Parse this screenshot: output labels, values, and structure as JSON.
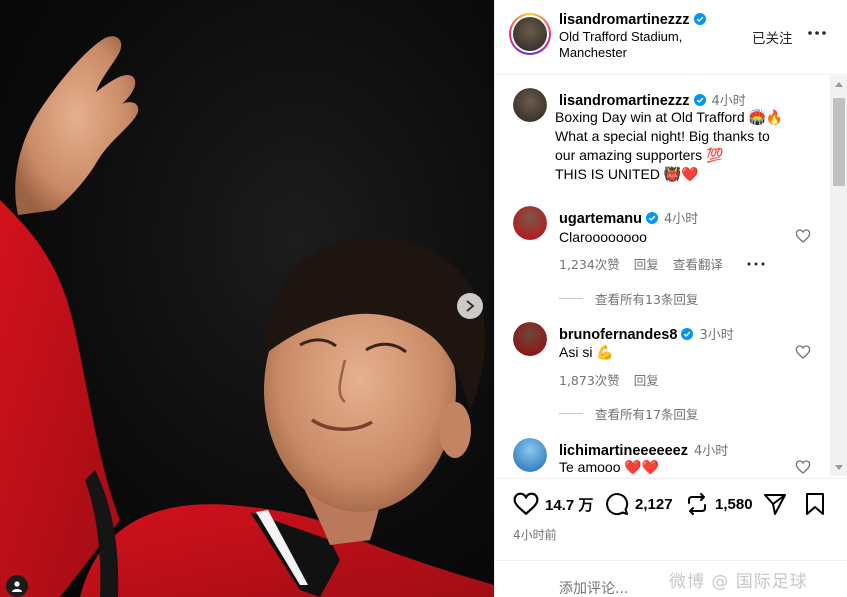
{
  "post": {
    "author": "lisandromartinezzz",
    "location_line1": "Old Trafford Stadium,",
    "location_line2": "Manchester",
    "follow_label": "已关注",
    "caption": {
      "time": "4小时",
      "lines": [
        "Boxing Day win at Old Trafford 🏟️🔥",
        "What a special night! Big thanks to",
        "our amazing supporters 💯",
        "THIS IS UNITED 👹❤️"
      ]
    }
  },
  "comments": [
    {
      "username": "ugartemanu",
      "verified": true,
      "time": "4小时",
      "text": "Claroooooooo",
      "likes": "1,234次赞",
      "reply": "回复",
      "translate": "查看翻译",
      "view_replies": "查看所有13条回复"
    },
    {
      "username": "brunofernandes8",
      "verified": true,
      "time": "3小时",
      "text": "Asi si 💪",
      "likes": "1,873次赞",
      "reply": "回复",
      "view_replies": "查看所有17条回复"
    },
    {
      "username": "lichimartineeeeeez",
      "verified": false,
      "time": "4小时",
      "text": "Te amooo ❤️❤️"
    }
  ],
  "actions": {
    "likes": "14.7 万",
    "comments": "2,127",
    "reposts": "1,580",
    "posted_ago": "4小时前"
  },
  "add_comment": {
    "placeholder": "添加评论..."
  },
  "watermark": "微博 @ 国际足球",
  "colors": {
    "verified": "#0095f6",
    "jersey_red": "#d3111c",
    "text_gray": "#737373"
  },
  "icons": [
    "verified-icon",
    "more-icon",
    "heart-icon",
    "comment-icon",
    "repost-icon",
    "share-icon",
    "bookmark-icon",
    "next-arrow-icon",
    "tag-user-icon"
  ]
}
